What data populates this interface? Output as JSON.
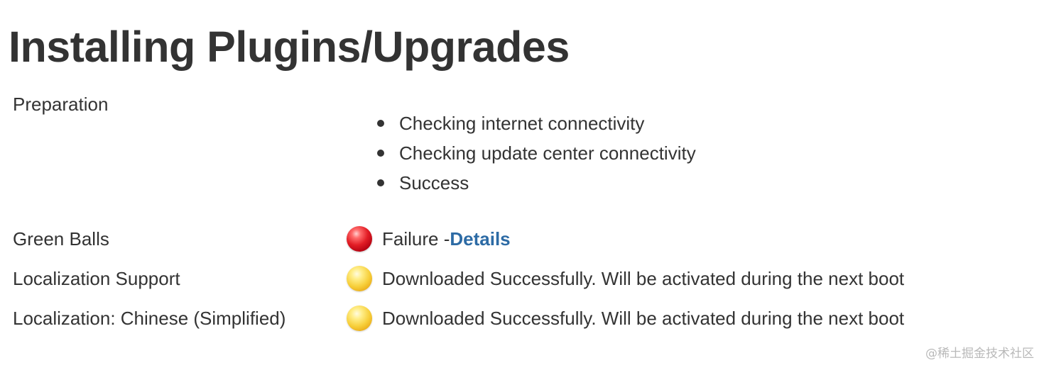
{
  "page": {
    "title": "Installing Plugins/Upgrades"
  },
  "preparation": {
    "label": "Preparation",
    "steps": [
      "Checking internet connectivity",
      "Checking update center connectivity",
      "Success"
    ]
  },
  "plugins": [
    {
      "name": "Green Balls",
      "status_icon": "red-ball-icon",
      "status_color": "#e21d25",
      "status_text": "Failure - ",
      "link_text": "Details"
    },
    {
      "name": "Localization Support",
      "status_icon": "yellow-ball-icon",
      "status_color": "#f7cf3a",
      "status_text": "Downloaded Successfully. Will be activated during the next boot"
    },
    {
      "name": "Localization: Chinese (Simplified)",
      "status_icon": "yellow-ball-icon",
      "status_color": "#f7cf3a",
      "status_text": "Downloaded Successfully. Will be activated during the next boot"
    }
  ],
  "colors": {
    "text": "#333333",
    "link": "#2d6ba5"
  },
  "watermark": "@稀土掘金技术社区"
}
